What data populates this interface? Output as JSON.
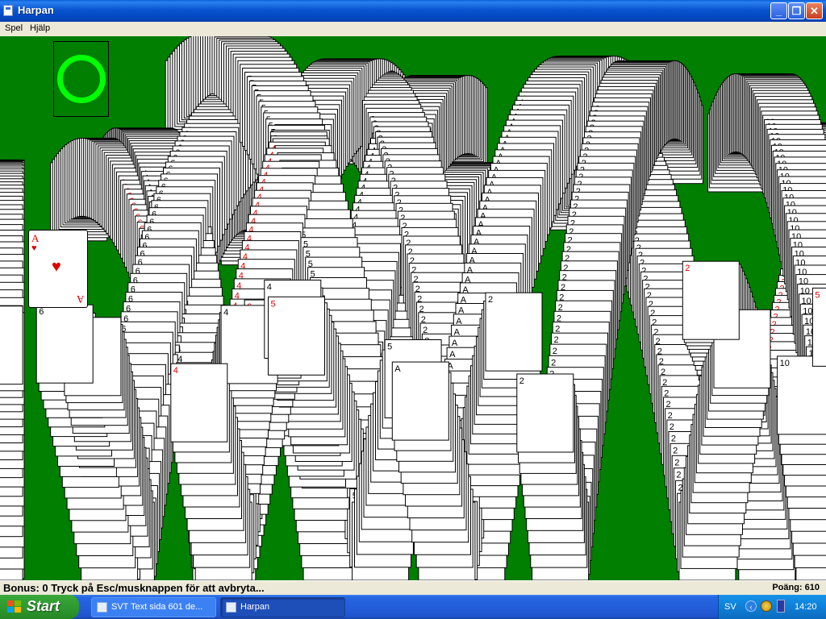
{
  "window": {
    "title": "Harpan"
  },
  "menu": {
    "items": [
      "Spel",
      "Hjälp"
    ]
  },
  "game": {
    "lead_card": {
      "rank": "A",
      "suit": "♥"
    },
    "rank_glyphs": [
      "A",
      "2",
      "3",
      "4",
      "5",
      "6",
      "10"
    ],
    "colors": {
      "felt": "#007f00",
      "stock_ring": "#00ff00",
      "red_suit": "#e00000",
      "black_suit": "#000000"
    }
  },
  "status": {
    "message": "Bonus: 0  Tryck på Esc/musknappen för att avbryta...",
    "score": "Poäng: 610"
  },
  "taskbar": {
    "start_label": "Start",
    "tasks": [
      {
        "label": "SVT Text sida 601 de..."
      },
      {
        "label": "Harpan"
      }
    ],
    "language": "SV",
    "clock": "14:20"
  }
}
